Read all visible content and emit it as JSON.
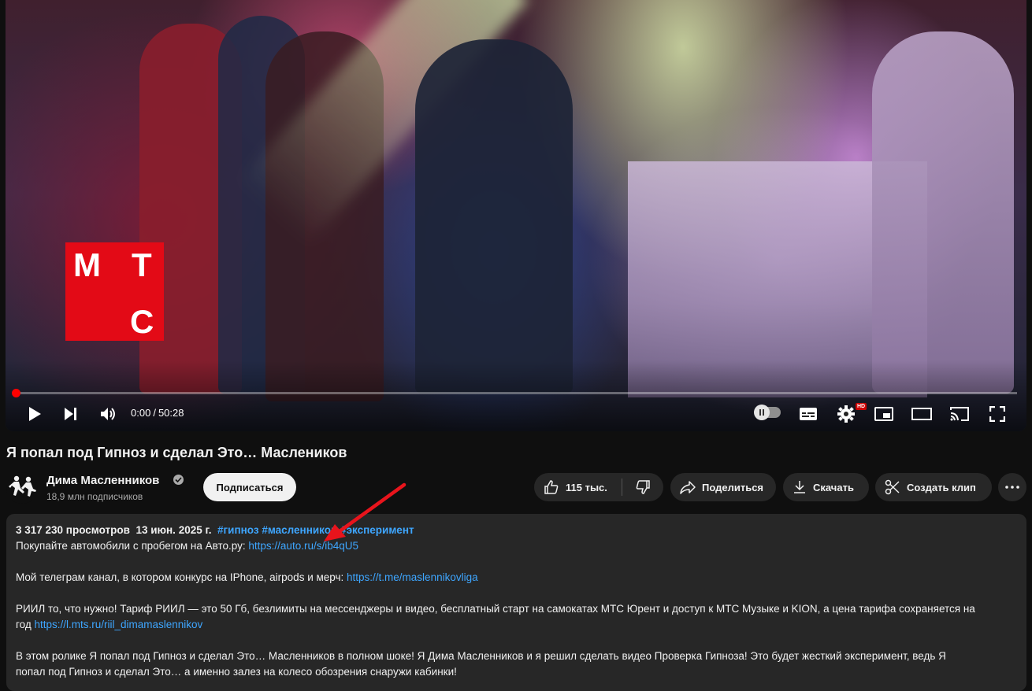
{
  "player": {
    "logo_letters": [
      "М",
      "Т",
      "С"
    ],
    "current_time": "0:00",
    "time_separator": "/",
    "duration": "50:28",
    "progress": 0,
    "hd_badge": "HD",
    "icons": [
      "play-icon",
      "next-icon",
      "volume-icon",
      "autoplay-toggle",
      "subtitles-icon",
      "settings-icon",
      "miniplayer-icon",
      "theater-icon",
      "cast-icon",
      "fullscreen-icon"
    ]
  },
  "video": {
    "title": "Я попал под Гипноз и сделал Это… Маслеников"
  },
  "channel": {
    "name": "Дима Масленников",
    "subscribers": "18,9 млн подписчиков",
    "subscribe_label": "Подписаться"
  },
  "actions": {
    "likes": "115 тыс.",
    "share": "Поделиться",
    "download": "Скачать",
    "clip": "Создать клип"
  },
  "description": {
    "views": "3 317 230 просмотров",
    "date": "13 июн. 2025 г.",
    "tags": [
      "#гипноз",
      "#масленников",
      "#эксперимент"
    ],
    "line1_text": "Покупайте автомобили с пробегом на Авто.ру: ",
    "line1_link": "https://auto.ru/s/ib4qU5",
    "line2_text": "Мой телеграм канал, в котором конкурс на IPhone, airpods и мерч: ",
    "line2_link": "https://t.me/maslennikovliga",
    "line3_text": "РИИЛ то, что нужно! Тариф РИИЛ — это 50 Гб, безлимиты на мессенджеры и видео, бесплатный старт на самокатах МТС Юрент и доступ к МТС Музыке и KION, а цена тарифа сохраняется на",
    "line4_text": "год ",
    "line4_link": "https://l.mts.ru/riil_dimamaslennikov",
    "line5_text": "В этом ролике Я попал под Гипноз и сделал Это… Масленников в полном шоке! Я Дима Масленников и я решил сделать видео Проверка Гипноза! Это будет жесткий эксперимент, ведь Я",
    "line6_text": "попал под Гипноз и сделал Это… а именно залез на колесо обозрения снаружи кабинки!"
  },
  "colors": {
    "background": "#0f0f0f",
    "surface": "#272727",
    "link": "#3ea6ff",
    "progress": "#ff0000",
    "logo": "#e30a16",
    "annotation_arrow": "#e8141c"
  }
}
